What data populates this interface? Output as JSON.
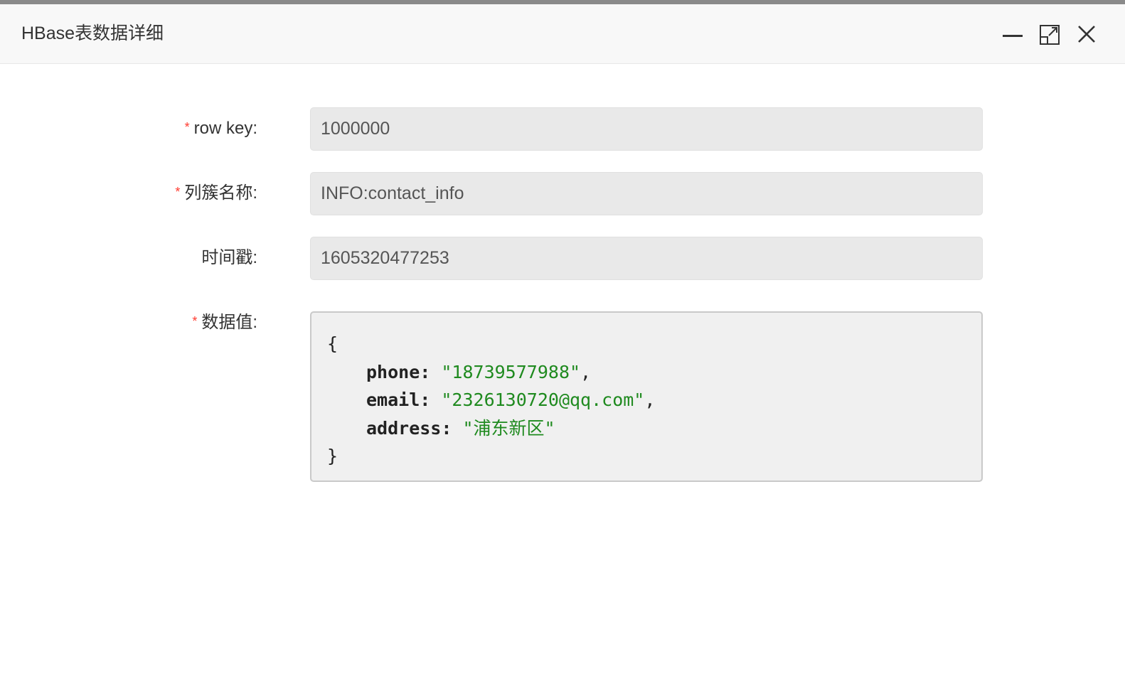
{
  "dialog": {
    "title": "HBase表数据详细"
  },
  "window_controls": {
    "minimize_icon": "minimize-icon",
    "maximize_icon": "maximize-icon",
    "close_icon": "close-icon"
  },
  "form": {
    "required_mark": "*",
    "row_key": {
      "label": "row key:",
      "value": "1000000",
      "required": true
    },
    "column_family": {
      "label": "列簇名称:",
      "value": "INFO:contact_info",
      "required": true
    },
    "timestamp": {
      "label": "时间戳:",
      "value": "1605320477253",
      "required": false
    },
    "data_value": {
      "label": "数据值:",
      "required": true,
      "open_brace": "{",
      "close_brace": "}",
      "fields": [
        {
          "key": "phone:",
          "value": "\"18739577988\"",
          "sep": ","
        },
        {
          "key": "email:",
          "value": "\"2326130720@qq.com\"",
          "sep": ","
        },
        {
          "key": "address:",
          "value": "\"浦东新区\"",
          "sep": ""
        }
      ]
    }
  },
  "colors": {
    "required": "#ff3b30",
    "json_string": "#1f8a1f",
    "input_bg": "#e9e9e9",
    "code_bg": "#f0f0f0"
  }
}
